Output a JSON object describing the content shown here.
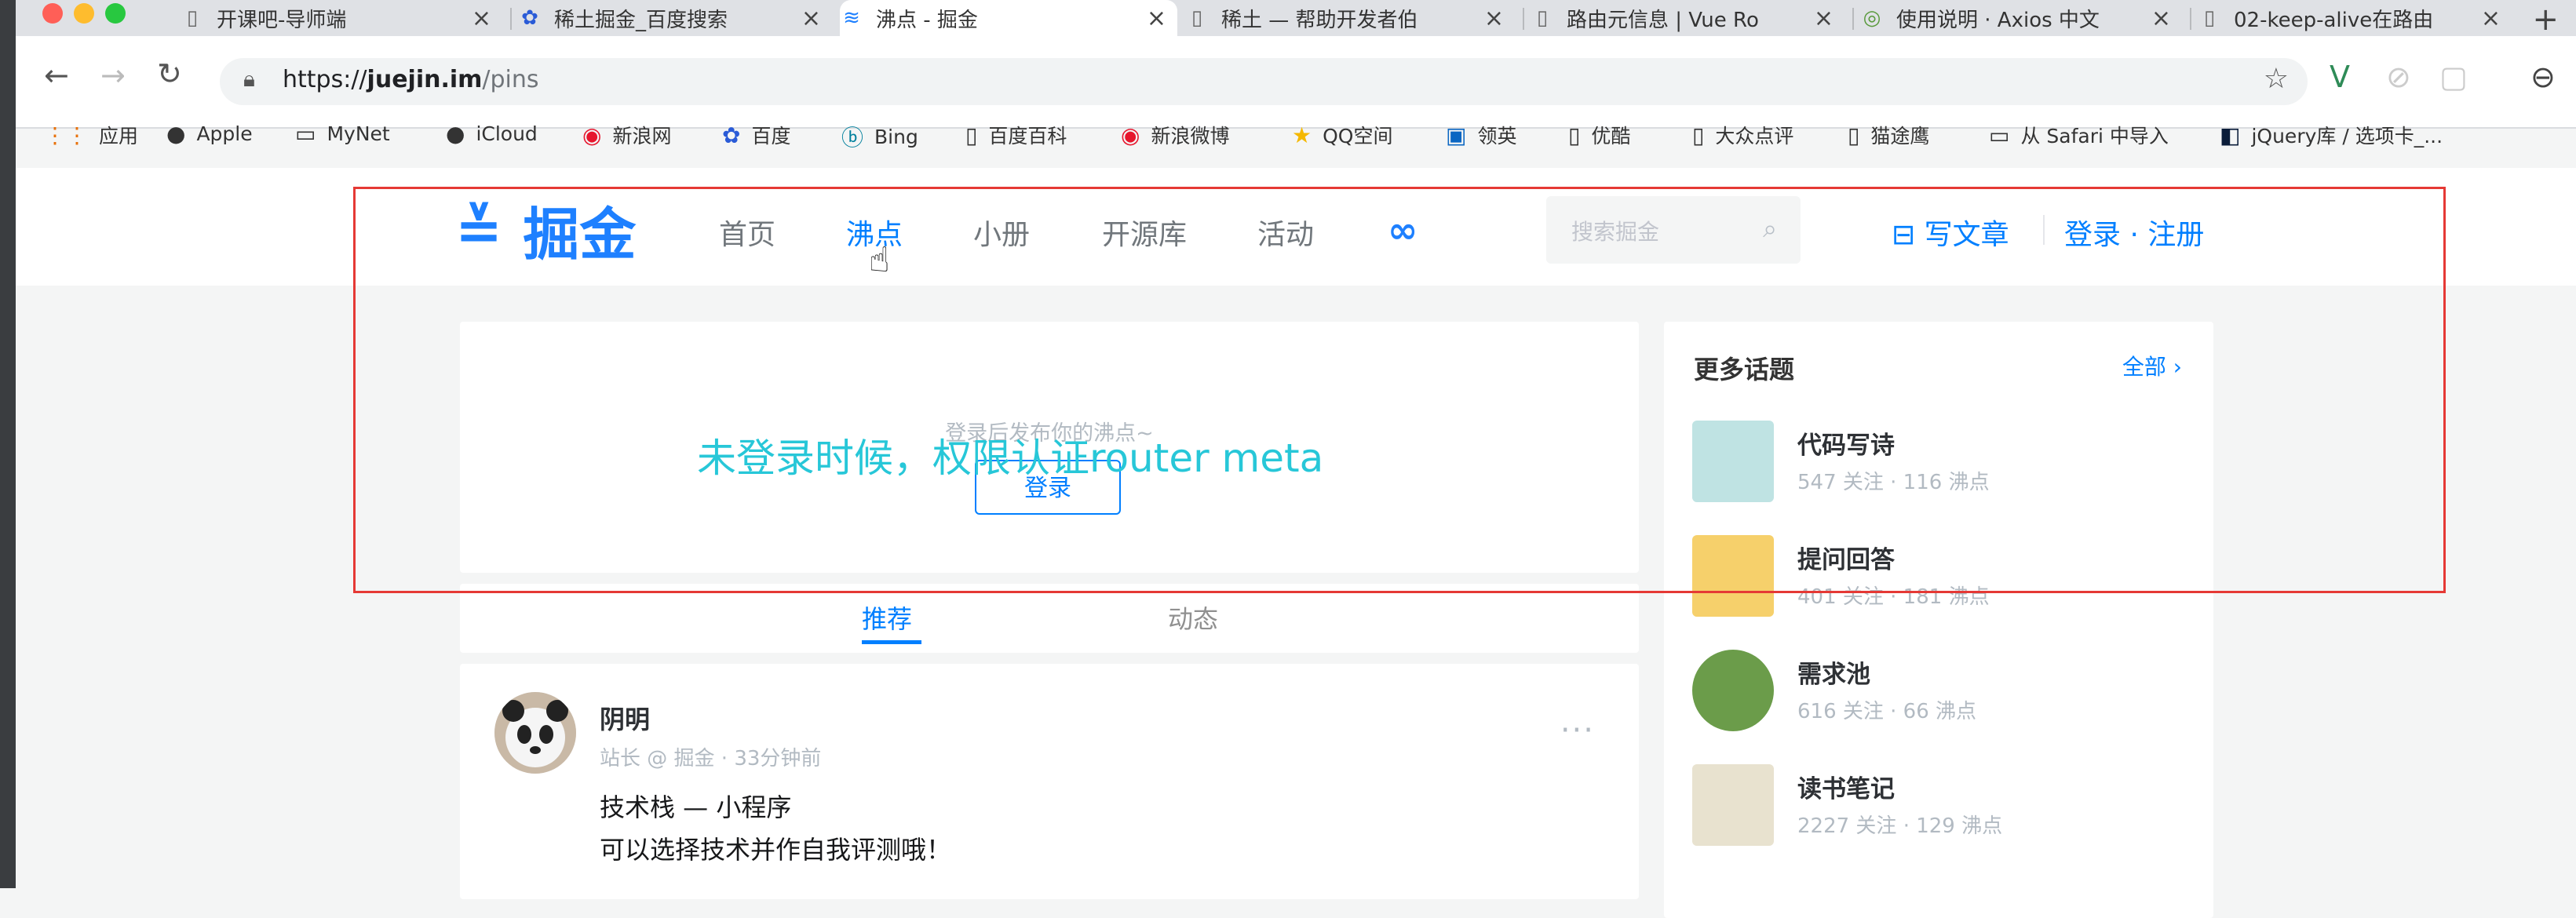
{
  "browser": {
    "tabs": [
      {
        "icon": "document-icon",
        "title": "开课吧-导师端"
      },
      {
        "icon": "paw-icon",
        "title": "稀土掘金_百度搜索"
      },
      {
        "icon": "juejin-icon",
        "title": "沸点 - 掘金"
      },
      {
        "icon": "document-icon",
        "title": "稀土 — 帮助开发者伯"
      },
      {
        "icon": "document-icon",
        "title": "路由元信息 | Vue Ro"
      },
      {
        "icon": "axios-icon",
        "title": "使用说明 · Axios 中文"
      },
      {
        "icon": "document-icon",
        "title": "02-keep-alive在路由"
      }
    ],
    "url": {
      "scheme": "https://",
      "host": "juejin.im",
      "path": "/pins"
    },
    "bookmarks": [
      {
        "icon": "apps-icon",
        "label": "应用"
      },
      {
        "icon": "apple-icon",
        "label": "Apple"
      },
      {
        "icon": "folder-icon",
        "label": "MyNet"
      },
      {
        "icon": "apple-icon",
        "label": "iCloud"
      },
      {
        "icon": "weibo-icon",
        "label": "新浪网"
      },
      {
        "icon": "paw-icon",
        "label": "百度"
      },
      {
        "icon": "bing-icon",
        "label": "Bing"
      },
      {
        "icon": "document-icon",
        "label": "百度百科"
      },
      {
        "icon": "weibo-icon",
        "label": "新浪微博"
      },
      {
        "icon": "star-icon",
        "label": "QQ空间"
      },
      {
        "icon": "linkedin-icon",
        "label": "领英"
      },
      {
        "icon": "document-icon",
        "label": "优酷"
      },
      {
        "icon": "document-icon",
        "label": "大众点评"
      },
      {
        "icon": "document-icon",
        "label": "猫途鹰"
      },
      {
        "icon": "folder-icon",
        "label": "从 Safari 中导入"
      },
      {
        "icon": "jquery-icon",
        "label": "jQuery库 / 选项卡_..."
      }
    ]
  },
  "site": {
    "logo_text": "掘金",
    "nav": [
      "首页",
      "沸点",
      "小册",
      "开源库",
      "活动"
    ],
    "search_placeholder": "搜索掘金",
    "write_label": "写文章",
    "login_label": "登录 · 注册"
  },
  "composer": {
    "hint": "登录后发布你的沸点~",
    "button": "登录"
  },
  "feed_tabs": [
    "推荐",
    "动态"
  ],
  "post": {
    "author": "阴明",
    "meta": "站长 @ 掘金 · 33分钟前",
    "line1": "技术栈 — 小程序",
    "line2": "可以选择技术并作自我评测哦！"
  },
  "sidebar": {
    "title": "更多话题",
    "all_label": "全部",
    "topics": [
      {
        "name": "代码写诗",
        "stats": "547 关注 · 116 沸点"
      },
      {
        "name": "提问回答",
        "stats": "401 关注 · 181 沸点"
      },
      {
        "name": "需求池",
        "stats": "616 关注 · 66 沸点"
      },
      {
        "name": "读书笔记",
        "stats": "2227 关注 · 129 沸点"
      }
    ]
  },
  "overlay": {
    "caption": "未登录时候，权限认证router meta"
  },
  "colors": {
    "accent": "#007fff",
    "annotation_box": "#e53935",
    "annotation_text": "#27c7d8"
  }
}
